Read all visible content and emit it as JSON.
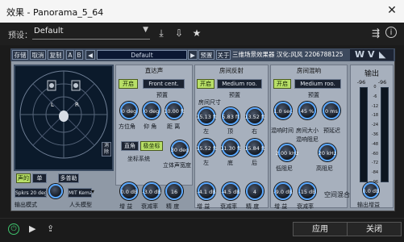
{
  "window": {
    "title": "效果 - Panorama_5_64",
    "close_icon": "close-icon"
  },
  "host": {
    "preset_label": "预设：",
    "preset_value": "Default",
    "icons": [
      "save-icon",
      "import-icon",
      "star-icon",
      "route-icon",
      "info-icon"
    ]
  },
  "plugin": {
    "toolbar": {
      "buttons": [
        "存储",
        "取消",
        "复制",
        "A",
        "B"
      ],
      "preset_value": "Default",
      "preset_btn": "预置",
      "about_btn": "关于",
      "name": "三维场景效果器 汉化:风风 2206788125"
    },
    "radar": {
      "left": "L",
      "right": "R",
      "side_label": "消除",
      "side_label2": "门"
    },
    "output_mode": {
      "stereo": "声的",
      "mono": "单",
      "multi": "多普勒"
    },
    "spk_label": "Spkrs 20 deg",
    "hrtf_value": "MIT Kemar",
    "output_mode_label": "输出模式",
    "hrtf_label": "人头模型",
    "direct": {
      "title": "直达声",
      "on": "开启",
      "mode": "Front cent.",
      "preset": "预置",
      "knobs": [
        {
          "value": "0 deg",
          "label": "方位角"
        },
        {
          "value": "0 deg",
          "label": "仰 角"
        },
        {
          "value": "10.00 ft",
          "label": "距 离"
        }
      ],
      "coord_a": "直角",
      "coord_b": "极坐标",
      "coord_label": "坐标系统",
      "width_value": "30 deg",
      "width_label": "立体声宽度"
    },
    "reflect": {
      "title": "房间反射",
      "on": "开启",
      "mode": "Medium roo.",
      "preset": "预置",
      "size_title": "房间尺寸",
      "size_knobs": [
        {
          "value": "15.13 ft",
          "label": "左"
        },
        {
          "value": "5.83 ft",
          "label": "顶"
        },
        {
          "value": "13.52 ft",
          "label": "右"
        }
      ],
      "wall_knobs": [
        {
          "value": "15.52 ft",
          "label": "左"
        },
        {
          "value": "11.30 ft",
          "label": "底"
        },
        {
          "value": "15.84 ft",
          "label": "后"
        }
      ],
      "mix_knobs": [
        {
          "value": "-4.1 dB",
          "label": "增 益"
        },
        {
          "value": "-4.5 dB",
          "label": "衰减率"
        },
        {
          "value": "4",
          "label": "精 度"
        }
      ]
    },
    "reverb": {
      "title": "房间混响",
      "on": "开启",
      "mode": "Medium roo.",
      "preset": "预置",
      "knobs": [
        {
          "value": "1.0 sec",
          "label": "混响时间"
        },
        {
          "value": "45 %",
          "label": "房间大小"
        },
        {
          "value": "0 ms",
          "label": "预延迟"
        }
      ],
      "damp_title": "混响阻尼",
      "damp_knobs": [
        {
          "value": "2.00 kHz",
          "label": "低阻尼"
        },
        {
          "value": "20 kHz",
          "label": "高阻尼"
        }
      ],
      "mix_knobs": [
        {
          "value": "-9.0 dB",
          "label": "增 益"
        },
        {
          "value": "-15 dB",
          "label": "衰减率"
        }
      ],
      "space_mix": "空间混合"
    },
    "direct_mix": [
      {
        "value": "0.0 dB",
        "label": "增 益"
      },
      {
        "value": "-3.0 dB",
        "label": "衰减率"
      },
      {
        "value": "16",
        "label": "精 度"
      }
    ],
    "output": {
      "title": "输出",
      "peak_left": "-96",
      "peak_right": "-96",
      "scale": [
        "0",
        "-6",
        "-12",
        "-18",
        "-24",
        "-36",
        "-48",
        "-60",
        "-72",
        "-84",
        "-96"
      ],
      "level_left": 0.0,
      "level_right": 0.0,
      "gain_value": "0.0 dB",
      "gain_label": "输出增益"
    }
  },
  "footer": {
    "apply": "应用",
    "close": "关闭",
    "icons": [
      "power-icon",
      "play-icon",
      "export-icon"
    ]
  },
  "colors": {
    "accent_green": "#b8df67",
    "knob_ring": "#5aa8ff",
    "plugin_bg": "#8f99a6"
  }
}
